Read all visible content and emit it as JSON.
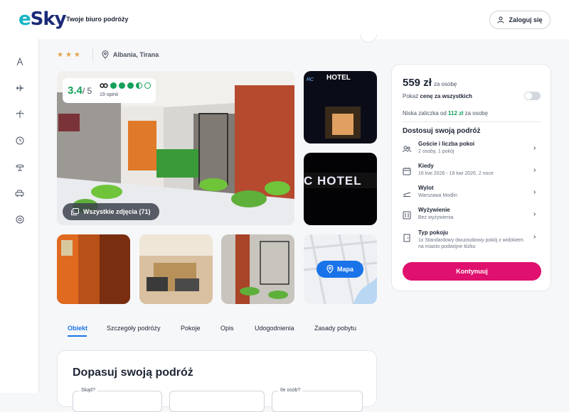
{
  "header": {
    "logo": "eSky",
    "tagline": "Twoje biuro podróży",
    "login_label": "Zaloguj się"
  },
  "sidebar": {
    "icons": [
      "hotel-icon",
      "plane-icon",
      "palm-tree-icon",
      "clock-icon",
      "beach-umbrella-icon",
      "car-icon",
      "lifebuoy-icon"
    ]
  },
  "breadcrumb": {
    "stars": "★★★",
    "location": "Albania, Tirana"
  },
  "gallery": {
    "rating_score": "3.4",
    "rating_max": "/ 5",
    "rating_count": "19 opinii",
    "rating_dots_value": 3.5,
    "all_photos_label": "Wszystkie zdjęcia (71)",
    "map_label": "Mapa"
  },
  "tabs": [
    {
      "label": "Obiekt",
      "active": true
    },
    {
      "label": "Szczegóły podróży"
    },
    {
      "label": "Pokoje"
    },
    {
      "label": "Opis"
    },
    {
      "label": "Udogodnienia"
    },
    {
      "label": "Zasady pobytu"
    }
  ],
  "adjust": {
    "title": "Dopasuj swoją podróż",
    "field_where_label": "Skąd?",
    "field_people_label": "Ile osób?"
  },
  "booking": {
    "price": "559 zł",
    "price_per": "za osobę",
    "show_all_prefix": "Pokaż ",
    "show_all_bold": "cenę za wszystkich",
    "deposit_prefix": "Niska zaliczka od ",
    "deposit_amount": "112 zł",
    "deposit_suffix": " za osobę",
    "customize_title": "Dostosuj swoją podróż",
    "options": [
      {
        "title": "Goście i liczba pokoi",
        "value": "2 osoby, 1 pokój",
        "icon": "guests-icon"
      },
      {
        "title": "Kiedy",
        "value": "16 kwi 2026 - 18 kwi 2026, 2 noce",
        "icon": "calendar-icon"
      },
      {
        "title": "Wylot",
        "value": "Warszawa Modlin",
        "icon": "plane-icon"
      },
      {
        "title": "Wyżywienie",
        "value": "Bez wyżywienia",
        "icon": "food-icon"
      },
      {
        "title": "Typ pokoju",
        "value": "1x Standardowy dwuosobowy pokój z widokiem na miasto podwójne łóżko",
        "icon": "door-icon"
      }
    ],
    "continue_label": "Kontynuuj"
  },
  "colors": {
    "accent": "#1a73e8",
    "rating_green": "#13a05a",
    "cta_pink": "#e0106e",
    "stars": "#e5a24a"
  }
}
